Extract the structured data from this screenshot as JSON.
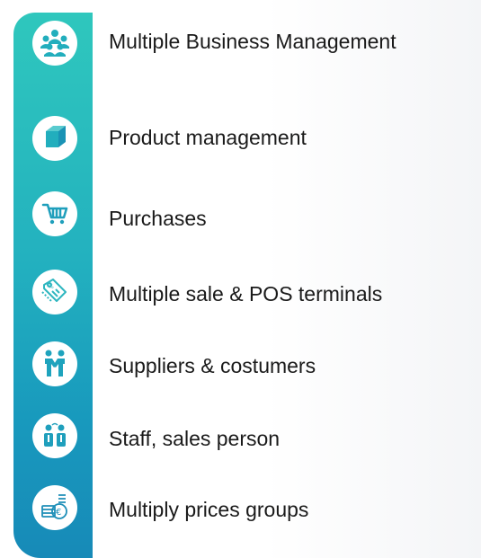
{
  "features": [
    {
      "label": "Multiple Business Management",
      "icon": "people-group-icon"
    },
    {
      "label": "Product management",
      "icon": "box-icon"
    },
    {
      "label": "Purchases",
      "icon": "shopping-cart-icon"
    },
    {
      "label": "Multiple sale & POS terminals",
      "icon": "price-tag-icon"
    },
    {
      "label": "Suppliers & costumers",
      "icon": "handshake-icon"
    },
    {
      "label": "Staff, sales person",
      "icon": "staff-icon"
    },
    {
      "label": "Multiply prices groups",
      "icon": "money-coins-icon"
    }
  ],
  "colors": {
    "bar_top": "#2fc7bd",
    "bar_bottom": "#178ab8",
    "icon_fill": "#ffffff",
    "text": "#1a1a1a"
  }
}
